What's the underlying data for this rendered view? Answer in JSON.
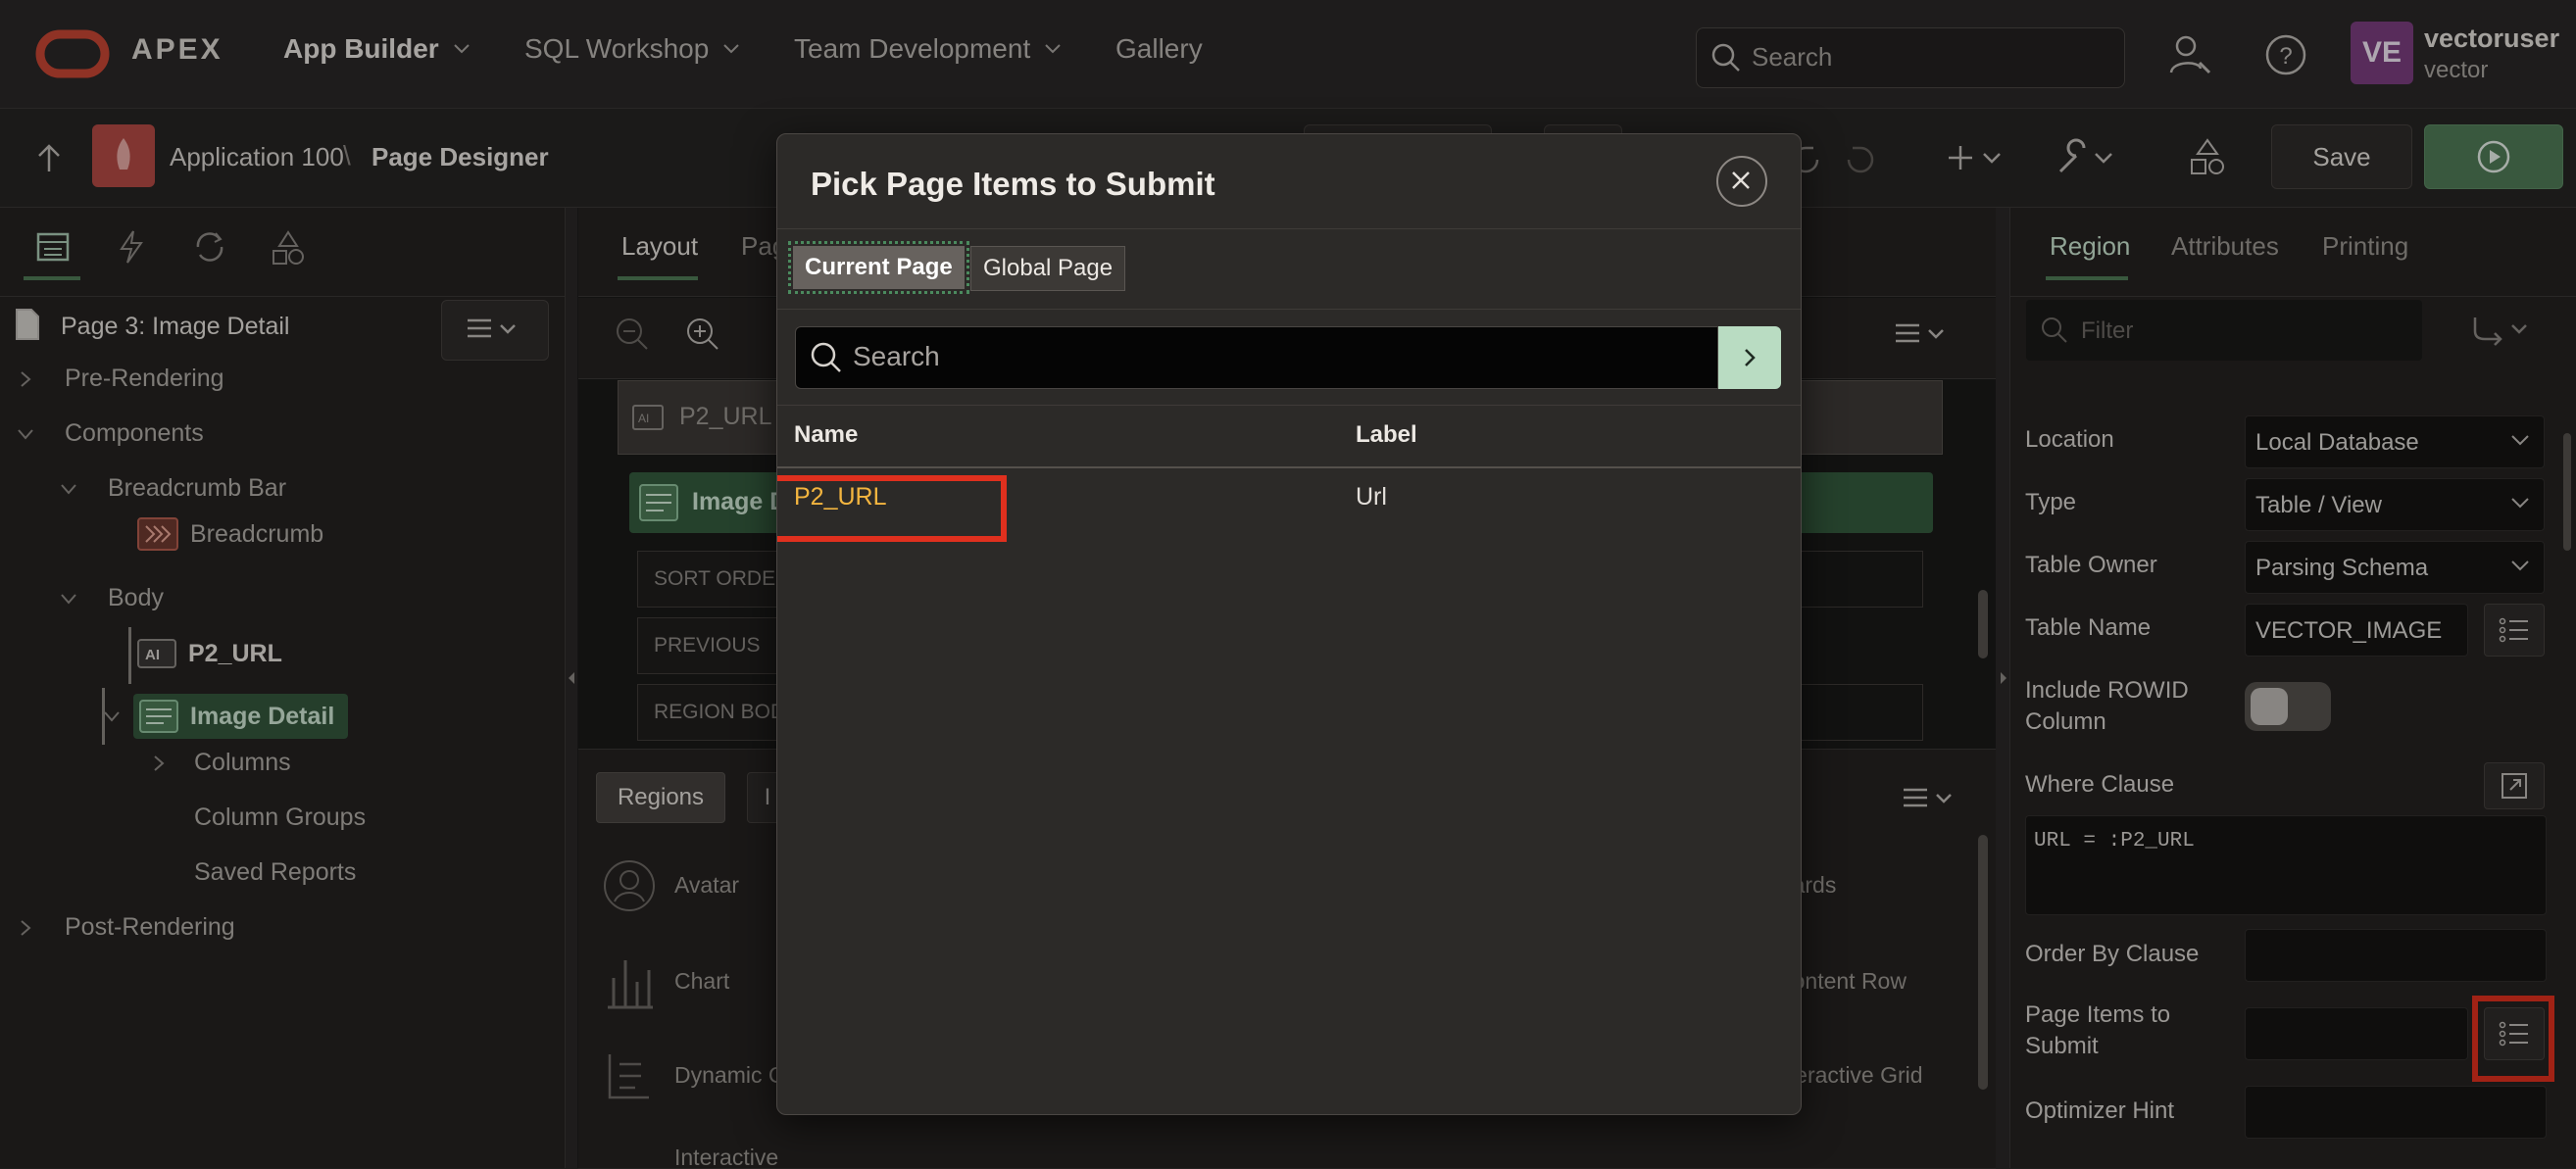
{
  "app": {
    "brand": "APEX",
    "nav": [
      {
        "label": "App Builder",
        "active": true
      },
      {
        "label": "SQL Workshop"
      },
      {
        "label": "Team Development"
      },
      {
        "label": "Gallery"
      }
    ],
    "search_placeholder": "Search",
    "user": {
      "initials": "VE",
      "name": "vectoruser",
      "workspace": "vector"
    }
  },
  "toolbar": {
    "app_name": "Application 100",
    "current": "Page Designer",
    "save_label": "Save"
  },
  "left": {
    "page_title": "Page 3: Image Detail",
    "tree": [
      {
        "label": "Pre-Rendering"
      },
      {
        "label": "Components"
      },
      {
        "label": "Breadcrumb Bar"
      },
      {
        "label": "Breadcrumb"
      },
      {
        "label": "Body"
      },
      {
        "label": "P2_URL"
      },
      {
        "label": "Image Detail"
      },
      {
        "label": "Columns"
      },
      {
        "label": "Column Groups"
      },
      {
        "label": "Saved Reports"
      },
      {
        "label": "Post-Rendering"
      }
    ]
  },
  "center": {
    "tabs": [
      "Layout",
      "Pag"
    ],
    "item_label": "P2_URL",
    "region_label": "Image D",
    "slots": [
      "SORT ORDER",
      "PREVIOUS",
      "REGION BODY"
    ],
    "gallery_tabs": [
      "Regions",
      "I"
    ],
    "gallery": [
      "Avatar",
      "Chart",
      "Dynamic C",
      "Interactive"
    ],
    "gallery_right": [
      "Cards",
      "Content Row",
      "nteractive Grid"
    ]
  },
  "right": {
    "tabs": [
      "Region",
      "Attributes",
      "Printing"
    ],
    "filter_placeholder": "Filter",
    "props": {
      "location": {
        "label": "Location",
        "value": "Local Database"
      },
      "type": {
        "label": "Type",
        "value": "Table / View"
      },
      "owner": {
        "label": "Table Owner",
        "value": "Parsing Schema"
      },
      "table": {
        "label": "Table Name",
        "value": "VECTOR_IMAGE"
      },
      "rowid": {
        "label": "Include ROWID Column",
        "value": "off"
      },
      "where": {
        "label": "Where Clause",
        "value": "URL = :P2_URL"
      },
      "order_by": {
        "label": "Order By Clause",
        "value": ""
      },
      "items_submit": {
        "label": "Page Items to Submit",
        "value": ""
      },
      "hint": {
        "label": "Optimizer Hint",
        "value": ""
      }
    }
  },
  "dialog": {
    "title": "Pick Page Items to Submit",
    "segments": [
      "Current Page",
      "Global Page"
    ],
    "search_placeholder": "Search",
    "columns": [
      "Name",
      "Label"
    ],
    "rows": [
      {
        "name": "P2_URL",
        "label": "Url"
      }
    ]
  },
  "colors": {
    "accent_green": "#4f7a57",
    "highlight_red": "#e0301e",
    "item_link": "#f4b53f"
  }
}
